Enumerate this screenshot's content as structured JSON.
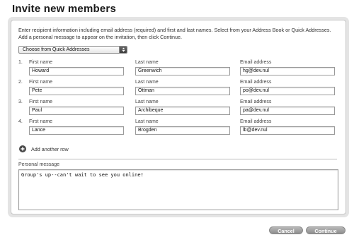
{
  "page": {
    "title": "Invite new members"
  },
  "instructions": "Enter recipient information including email address (required) and first and last names. Select from your Address Book or Quick Addresses. Add a personal message to appear on the invitation, then click Continue.",
  "address_select": {
    "selected": "Choose from Quick Addresses"
  },
  "labels": {
    "first_name": "First name",
    "last_name": "Last name",
    "email": "Email address"
  },
  "recipients": [
    {
      "num": "1.",
      "first": "Howard",
      "last": "Greenwich",
      "email": "hg@dev.nul"
    },
    {
      "num": "2.",
      "first": "Pete",
      "last": "Ottman",
      "email": "po@dev.nul"
    },
    {
      "num": "3.",
      "first": "Paul",
      "last": "Archibeque",
      "email": "pa@dev.nul"
    },
    {
      "num": "4.",
      "first": "Lance",
      "last": "Brogden",
      "email": "lb@dev.nul"
    }
  ],
  "add_row": {
    "label": "Add another row",
    "icon": "plus-circle-icon"
  },
  "message": {
    "label": "Personal message",
    "value": "Group's up--can't wait to see you online!"
  },
  "buttons": {
    "cancel": "Cancel",
    "continue": "Continue"
  }
}
